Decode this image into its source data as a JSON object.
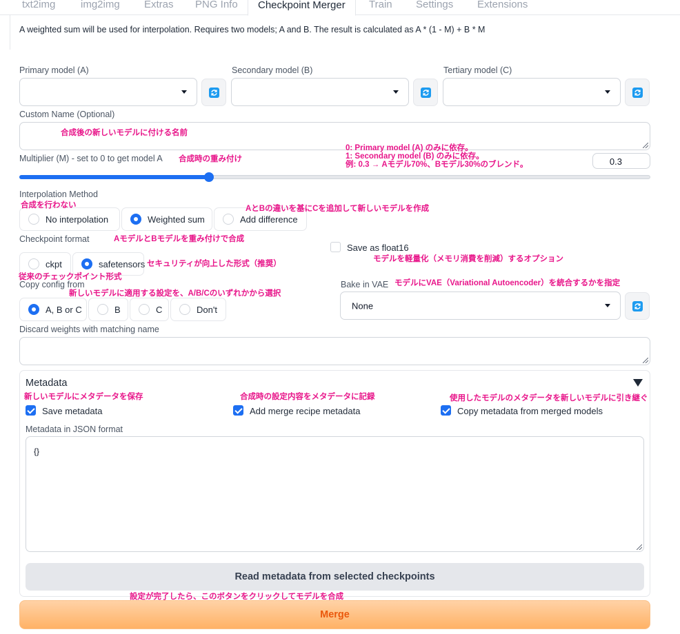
{
  "tabs": [
    "txt2img",
    "img2img",
    "Extras",
    "PNG Info",
    "Checkpoint Merger",
    "Train",
    "Settings",
    "Extensions"
  ],
  "description": "A weighted sum will be used for interpolation. Requires two models; A and B. The result is calculated as A * (1 - M) + B * M",
  "models": {
    "primary_label": "Primary model (A)",
    "secondary_label": "Secondary model (B)",
    "tertiary_label": "Tertiary model (C)",
    "primary_value": "",
    "secondary_value": "",
    "tertiary_value": ""
  },
  "custom_name": {
    "label": "Custom Name (Optional)",
    "value": ""
  },
  "multiplier": {
    "label": "Multiplier (M) - set to 0 to get model A",
    "value": "0.3",
    "fraction": 0.3
  },
  "interpolation": {
    "label": "Interpolation Method",
    "options": [
      "No interpolation",
      "Weighted sum",
      "Add difference"
    ],
    "selected": "Weighted sum"
  },
  "checkpoint_format": {
    "label": "Checkpoint format",
    "options": [
      "ckpt",
      "safetensors"
    ],
    "selected": "safetensors"
  },
  "float16": {
    "label": "Save as float16",
    "checked": false
  },
  "copy_config": {
    "label": "Copy config from",
    "options": [
      "A, B or C",
      "B",
      "C",
      "Don't"
    ],
    "selected": "A, B or C"
  },
  "bake_vae": {
    "label": "Bake in VAE",
    "value": "None"
  },
  "discard": {
    "label": "Discard weights with matching name",
    "value": ""
  },
  "metadata": {
    "title": "Metadata",
    "save_metadata": "Save metadata",
    "add_recipe": "Add merge recipe metadata",
    "copy_metadata": "Copy metadata from merged models",
    "json_label": "Metadata in JSON format",
    "json_value": "{}",
    "read_button": "Read metadata from selected checkpoints"
  },
  "merge_button": "Merge",
  "colors": {
    "accent": "#1d6ff2",
    "annotation": "#e8168a",
    "merge_text": "#ea580c"
  },
  "annotations": {
    "custom_name": "合成後の新しいモデルに付ける名前",
    "multiplier": "合成時の重み付け",
    "m0": "0: Primary model (A) のみに依存。",
    "m1": "1: Secondary model (B) のみに依存。",
    "mex": "例: 0.3 → Aモデル70%、Bモデル30%のブレンド。",
    "no_interp": "合成を行わない",
    "add_diff": "AとBの違いを基にCを追加して新しいモデルを作成",
    "weighted": "AモデルとBモデルを重み付けで合成",
    "safetensors": "セキュリティが向上した形式（推奨）",
    "float16": "モデルを軽量化（メモリ消費を削減）するオプション",
    "ckpt": "従来のチェックポイント形式",
    "copy_config": "新しいモデルに適用する設定を、A/B/Cのいずれかから選択",
    "bake_vae": "モデルにVAE（Variational Autoencoder）を統合するかを指定",
    "save_meta": "新しいモデルにメタデータを保存",
    "recipe": "合成時の設定内容をメタデータに記録",
    "copy_meta": "使用したモデルのメタデータを新しいモデルに引き継ぐ",
    "merge": "設定が完了したら、このボタンをクリックしてモデルを合成"
  }
}
